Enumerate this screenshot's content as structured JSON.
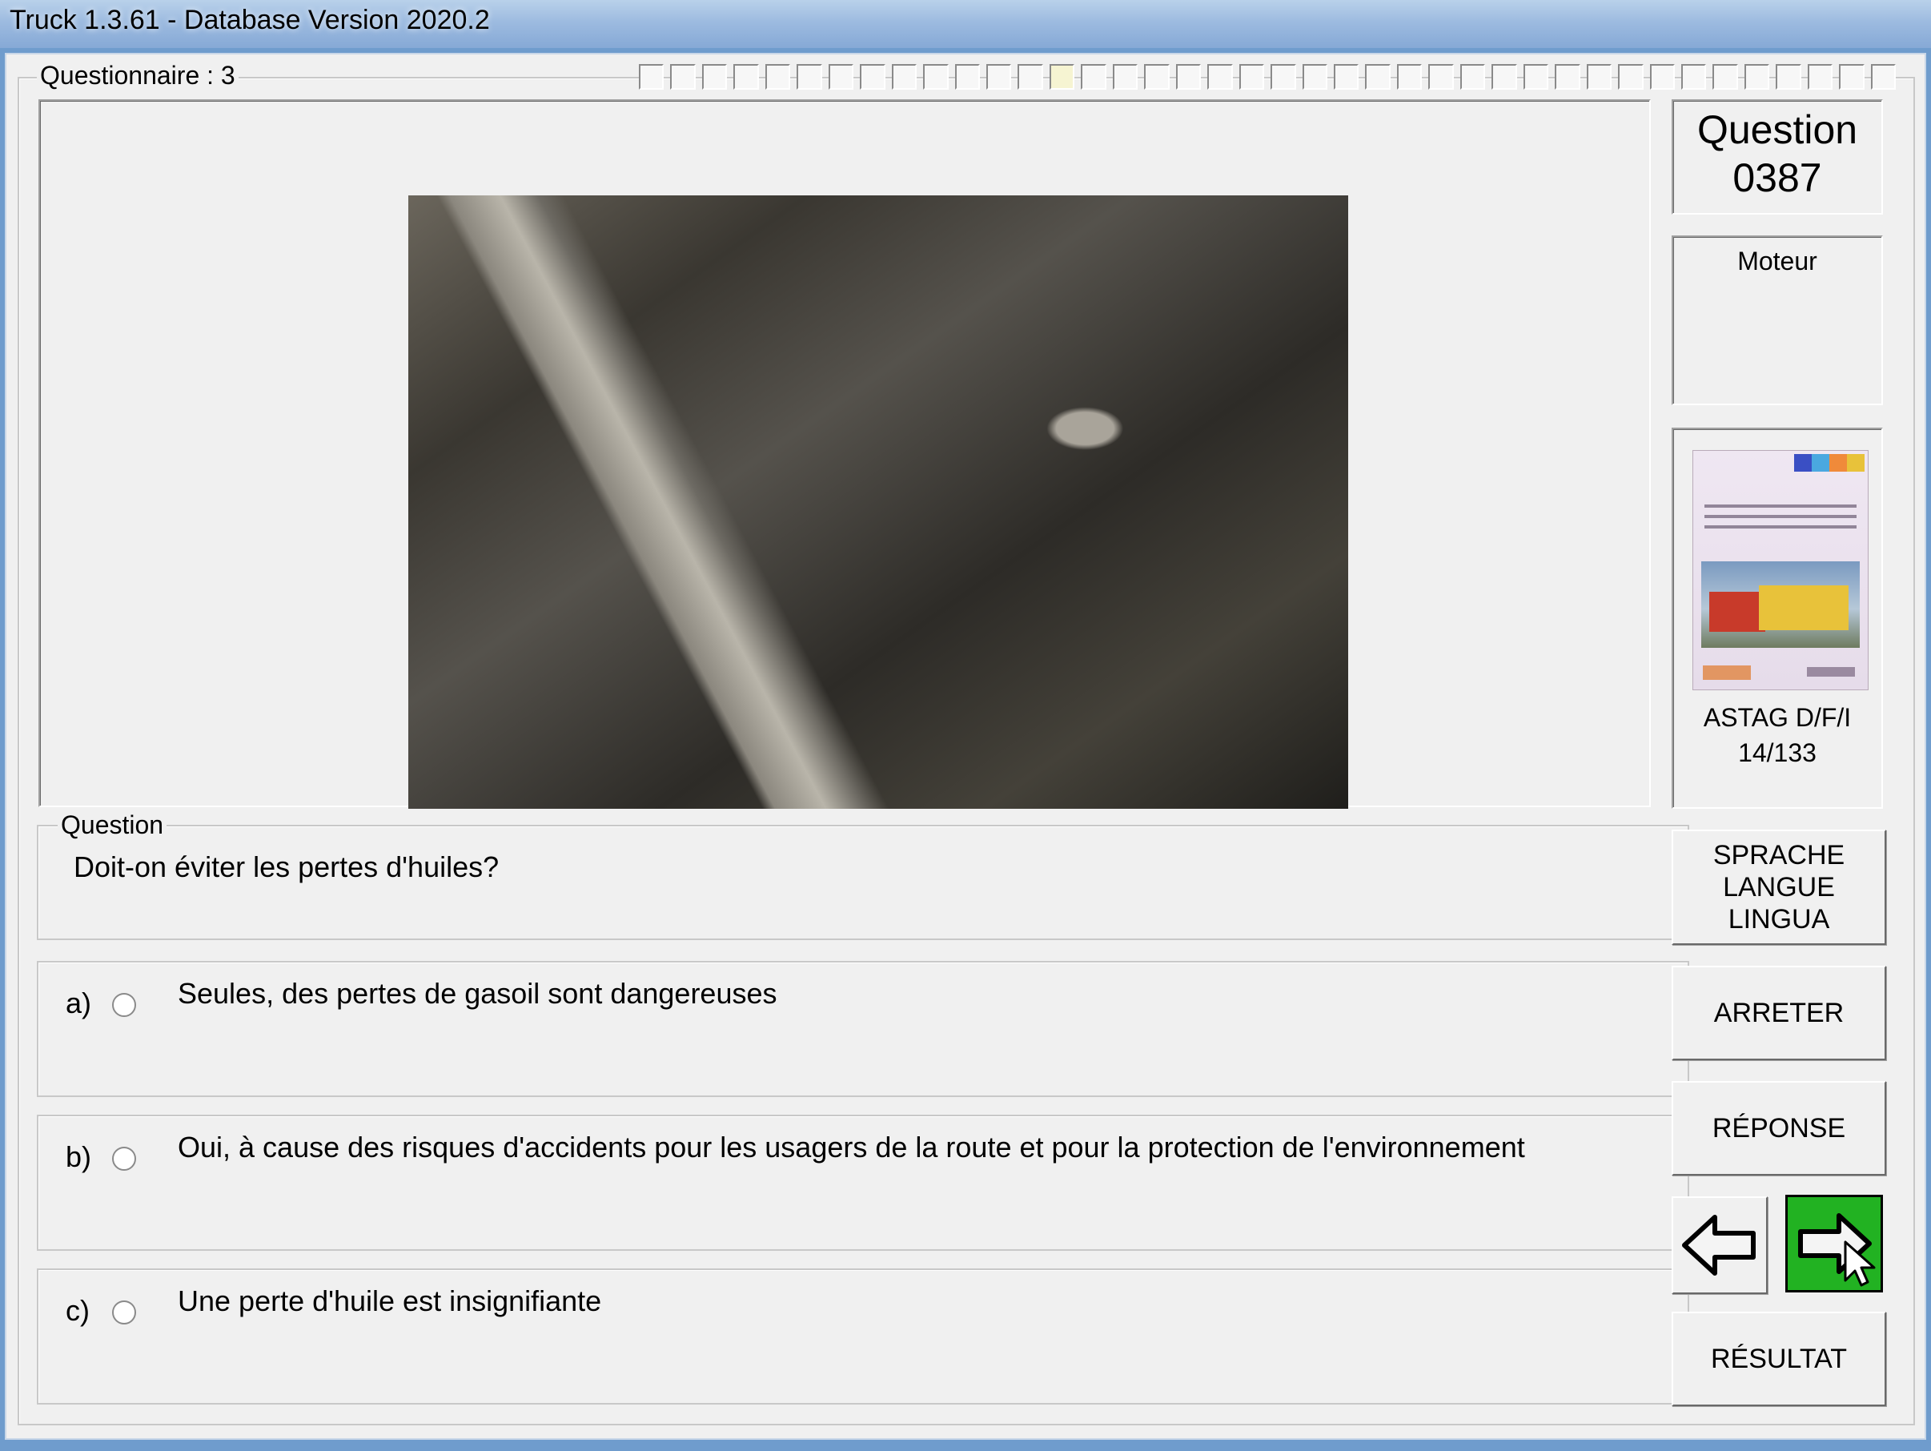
{
  "window": {
    "title": "Truck 1.3.61 - Database Version 2020.2"
  },
  "questionnaire": {
    "label": "Questionnaire : 3",
    "progress_done": 14,
    "progress_total": 40
  },
  "info": {
    "question_label": "Question",
    "question_number": "0387",
    "category": "Moteur",
    "source_title": "ASTAG D/F/I",
    "source_page": "14/133"
  },
  "book": {
    "badge_colors": [
      "#3a4fc4",
      "#4aa8e0",
      "#f08a3a",
      "#e8c23a"
    ]
  },
  "question": {
    "legend": "Question",
    "text": "Doit-on éviter les pertes d'huiles?"
  },
  "answers": [
    {
      "letter": "a)",
      "text": "Seules, des pertes de gasoil sont dangereuses"
    },
    {
      "letter": "b)",
      "text": "Oui, à cause des risques d'accidents pour les usagers de la route et pour la protection de l'environnement"
    },
    {
      "letter": "c)",
      "text": "Une perte d'huile est insignifiante"
    }
  ],
  "buttons": {
    "language": "SPRACHE\nLANGUE\nLINGUA",
    "stop": "ARRETER",
    "answer": "RÉPONSE",
    "result": "RÉSULTAT"
  },
  "colors": {
    "next_button": "#22b222",
    "title_gradient": "#9dbbe0"
  }
}
